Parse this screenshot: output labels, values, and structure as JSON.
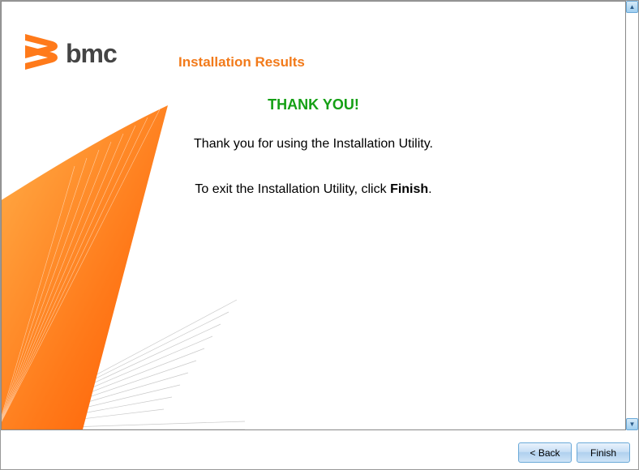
{
  "logo": {
    "text": "bmc"
  },
  "title": "Installation Results",
  "thankyou": "THANK YOU!",
  "body": {
    "line1": "Thank you for using the Installation Utility.",
    "line2_prefix": "To exit the Installation Utility, click ",
    "line2_bold": "Finish",
    "line2_suffix": "."
  },
  "buttons": {
    "back": "< Back",
    "finish": "Finish"
  },
  "colors": {
    "accent": "#f27a1a",
    "success": "#15a015"
  }
}
